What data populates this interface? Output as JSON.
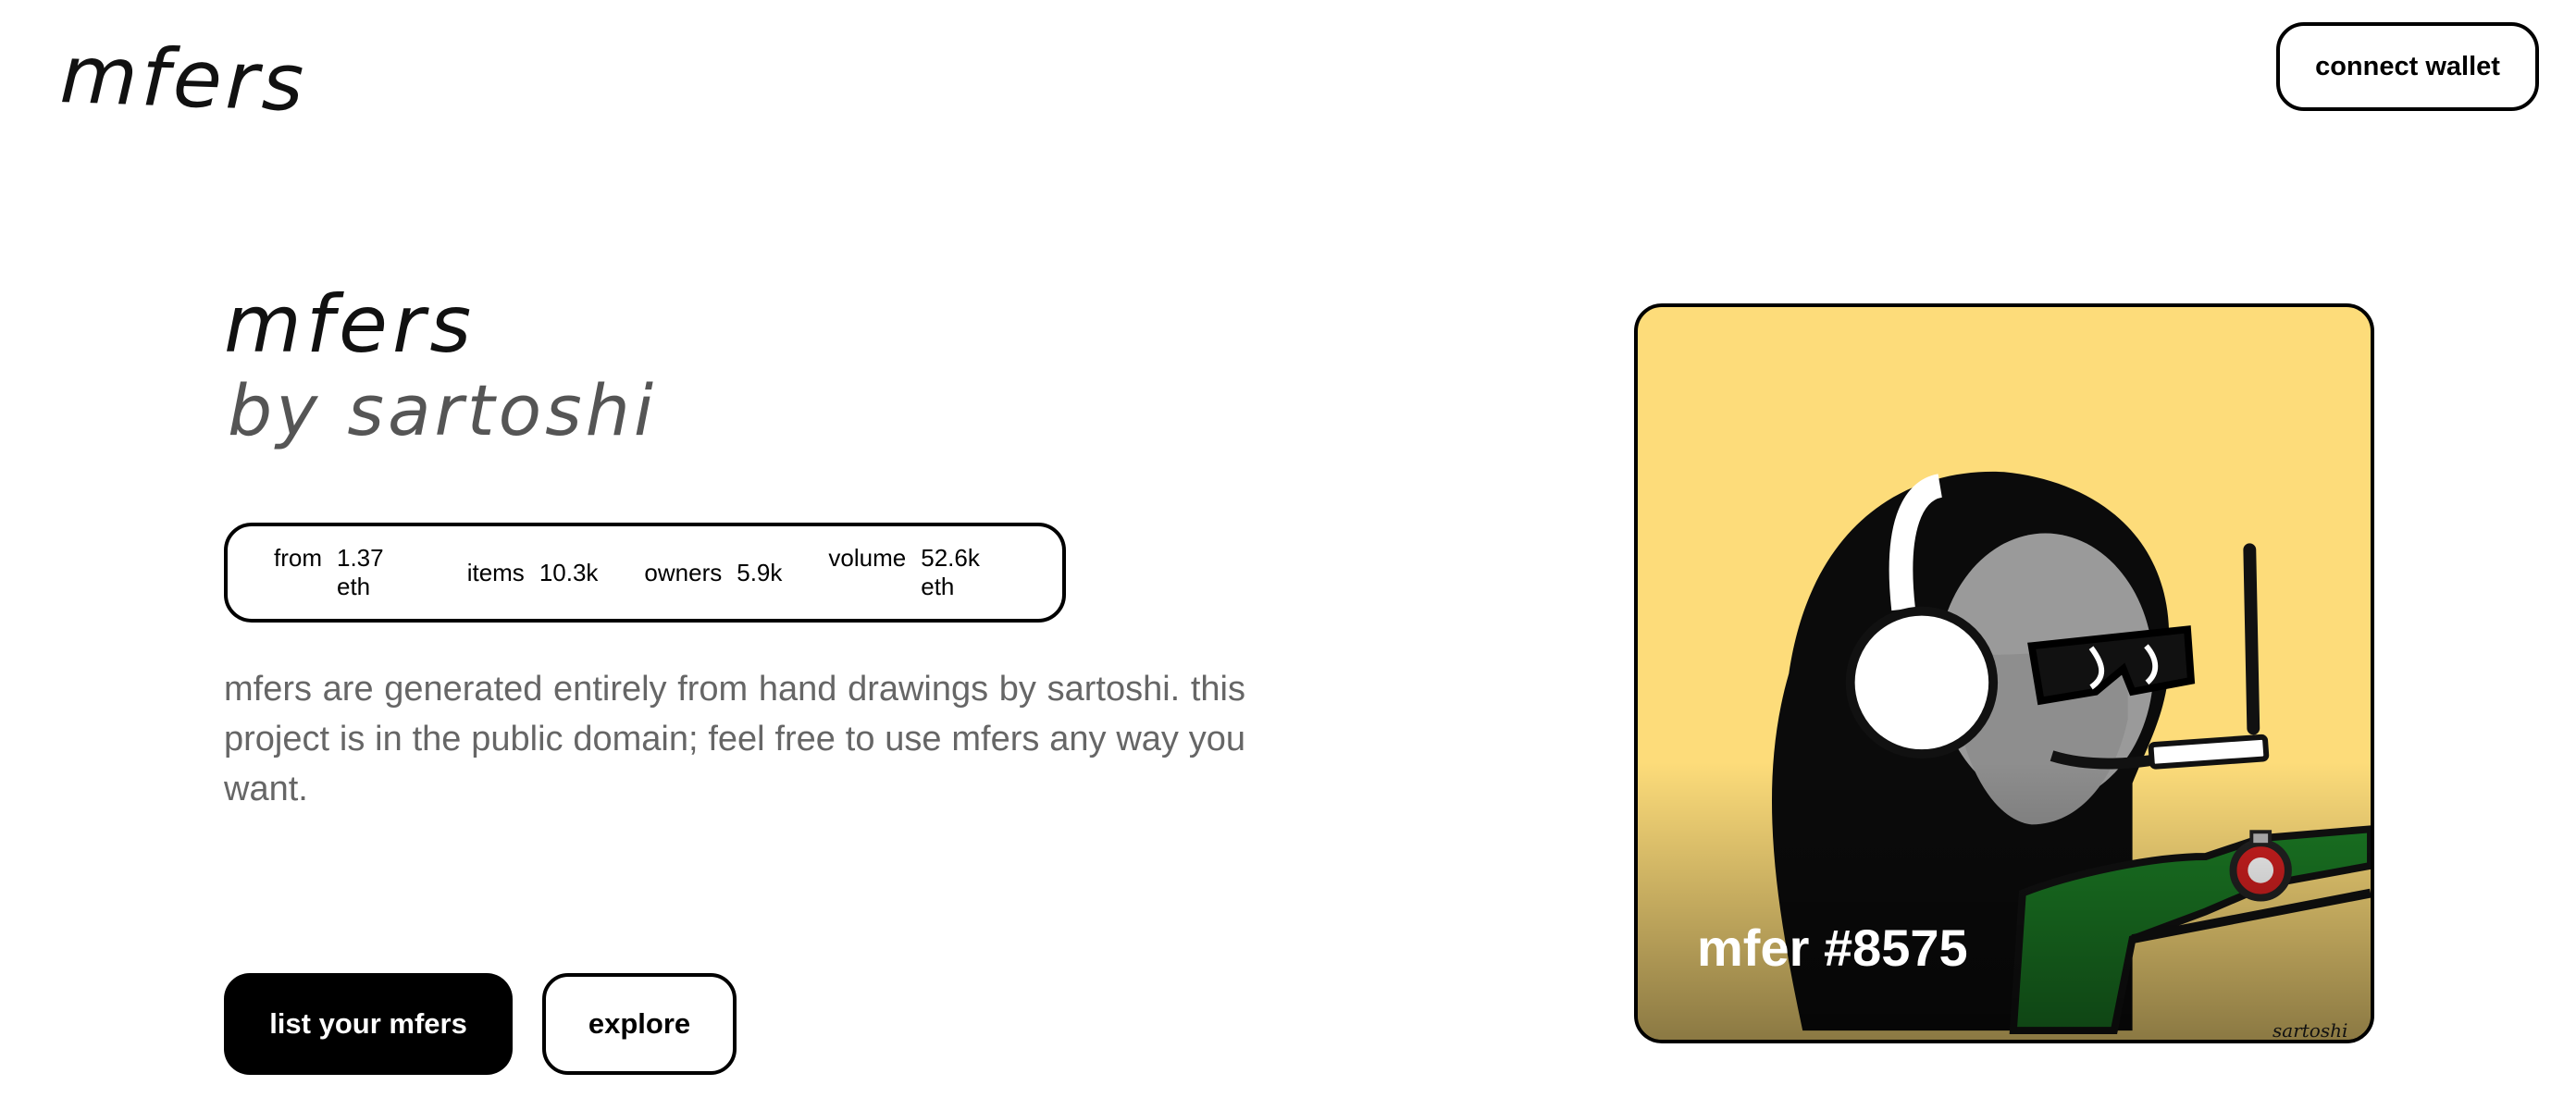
{
  "header": {
    "logo_text": "mfers",
    "connect_label": "connect wallet"
  },
  "hero": {
    "title_line1": "mfers",
    "title_line2": "by sartoshi",
    "stats": [
      {
        "label": "from",
        "value": "1.37 eth"
      },
      {
        "label": "items",
        "value": "10.3k"
      },
      {
        "label": "owners",
        "value": "5.9k"
      },
      {
        "label": "volume",
        "value": "52.6k eth"
      }
    ],
    "description": "mfers are generated entirely from hand drawings by sartoshi. this project is in the public domain; feel free to use mfers any way you want.",
    "primary_button": "list your mfers",
    "secondary_button": "explore"
  },
  "card": {
    "title": "mfer #8575",
    "signature": "sartoshi",
    "background_color": "#fddc7a"
  },
  "colors": {
    "text": "#000000",
    "muted": "#666666",
    "title_secondary": "#555555",
    "card_bg": "#fddc7a"
  }
}
